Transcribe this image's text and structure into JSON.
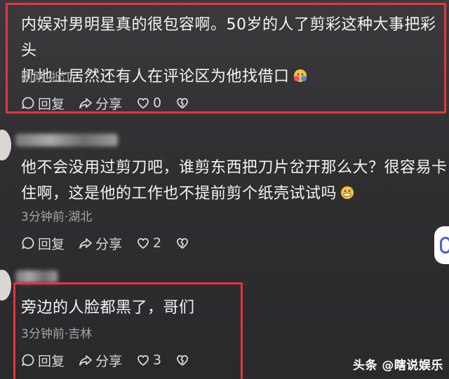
{
  "comments": [
    {
      "text_line1": "内娱对男明星真的很包容啊。50岁的人了剪彩这种大事把彩头",
      "text_line2": "扔地上居然还有人在评论区为他找借口",
      "emoji": "hugging-face-emoji",
      "meta": "刚刚·浙江",
      "reply": "回复",
      "share": "分享",
      "likes": "0"
    },
    {
      "text_line1": "他不会没用过剪刀吧，谁剪东西把刀片岔开那么大？很容易卡",
      "text_line2": "住啊，这是他的工作也不提前剪个纸壳试试吗",
      "emoji": "grimacing-sweat-emoji",
      "meta": "3分钟前·湖北",
      "reply": "回复",
      "share": "分享",
      "likes": "2"
    },
    {
      "text_line1": "旁边的人脸都黑了，哥们",
      "meta": "3分钟前·吉林",
      "reply": "回复",
      "share": "分享",
      "likes": "3"
    }
  ],
  "watermark": "头条 @瞎说娱乐",
  "colors": {
    "highlight_box": "#e3363d",
    "background": "#2e2d30",
    "accent": "#4b63d8"
  }
}
